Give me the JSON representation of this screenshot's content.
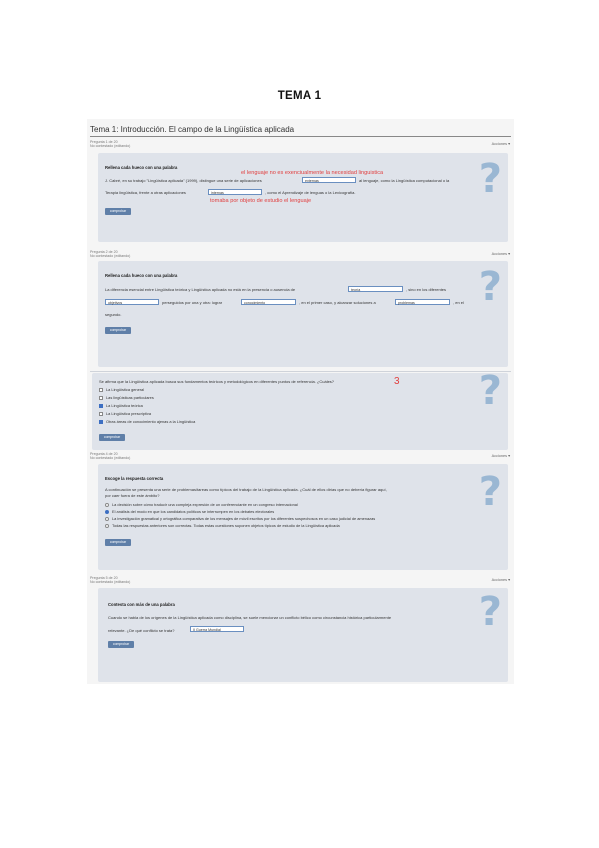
{
  "document": {
    "title": "TEMA 1"
  },
  "quiz": {
    "title": "Tema 1: Introducción. El campo de la Lingüística aplicada",
    "actions_label": "Acciones ▾",
    "q1": {
      "meta_line1": "Pregunta 1 de 20",
      "meta_line2": "No contestado (editando)",
      "heading": "Rellena cada hueco con una palabra",
      "text1": "J. Cabré, en su trabajo \"Lingüística aplicada\" (1999), distingue una serie de aplicaciones",
      "gap1": "externas",
      "text2": "al lenguaje, como la Lingüística computacional o la",
      "text3": "Terapia lingüística, frente a otras aplicaciones",
      "gap2": "internas",
      "text4": ", como el Aprendizaje de lenguas o la Lexicografía.",
      "annotation1": "el lenguaje no es exenciualmente la necesidad linguistica",
      "annotation2": "tomaba por objeto de estudio el lenguaje",
      "button": "comprobar"
    },
    "q2": {
      "meta_line1": "Pregunta 2 de 20",
      "meta_line2": "No contestado (editando)",
      "heading": "Rellena cada hueco con una palabra",
      "text1": "La diferencia esencial entre Lingüística teórica y Lingüística aplicada no está en la presencia o ausencia de",
      "gap1": "teoría",
      "text2": ", sino en los diferentes",
      "gap2": "objetivos",
      "text3": "perseguidos por una y otra: lograr",
      "gap3": "conocimiento",
      "text4": ", en el primer caso, y alcanzar soluciones a",
      "gap4": "problemas",
      "text5": ", en el",
      "text6": "segundo.",
      "button": "comprobar"
    },
    "q3": {
      "question": "Se afirma que la Lingüística aplicada busca sus fundamentos teóricos y metodológicos en diferentes puntos de referencia. ¿Cuáles?",
      "annotation": "3",
      "options": [
        {
          "label": "La Lingüística general",
          "checked": false
        },
        {
          "label": "Las lingüísticas particulares",
          "checked": false
        },
        {
          "label": "La Lingüística teórica",
          "checked": true
        },
        {
          "label": "La Lingüística prescriptiva",
          "checked": false
        },
        {
          "label": "Otras áreas de conocimiento ajenas a la Lingüística",
          "checked": true
        }
      ],
      "button": "comprobar"
    },
    "q4": {
      "meta_line1": "Pregunta 4 de 20",
      "meta_line2": "No contestado (editando)",
      "heading": "Escoge la respuesta correcta",
      "question1": "A continuación se presenta una serie de problemas/tareas como típicos del trabajo de la Lingüística aplicada. ¿Cuál de ellos dirías que no debería figurar aquí,",
      "question2": "por caer fuera de este ámbito?",
      "options": [
        {
          "label": "La decisión sobre cómo traducir una compleja expresión de un conferenciante en un congreso internacional",
          "selected": false
        },
        {
          "label": "El análisis del modo en que los candidatos políticos se interrumpen en los debates electorales",
          "selected": true
        },
        {
          "label": "La investigación gramatical y ortográfica comparativa de los mensajes de móvil escritos por los diferentes sospechosos en un caso judicial de amenazas",
          "selected": false
        },
        {
          "label": "Todas las respuestas anteriores son correctas. Todas estas cuestiones suponen objetos típicos de estudio de la Lingüística aplicada",
          "selected": false
        }
      ],
      "button": "comprobar"
    },
    "q5": {
      "meta_line1": "Pregunta 5 de 20",
      "meta_line2": "No contestado (editando)",
      "heading": "Contesta con más de una palabra",
      "text1": "Cuando se habla de los orígenes de la Lingüística aplicada como disciplina, se suele mencionar un conflicto bélico como circunstancia histórica particularmente",
      "text2": "relevante. ¿De qué conflicto se trata?",
      "answer": "II Guerra Mundial",
      "button": "comprobar"
    }
  },
  "icons": {
    "help": "question-mark-icon"
  },
  "colors": {
    "card": "#dfe3ea",
    "button": "#5f7fa8",
    "annotation": "#e03e3e",
    "qmark": "#9ab7d3"
  }
}
